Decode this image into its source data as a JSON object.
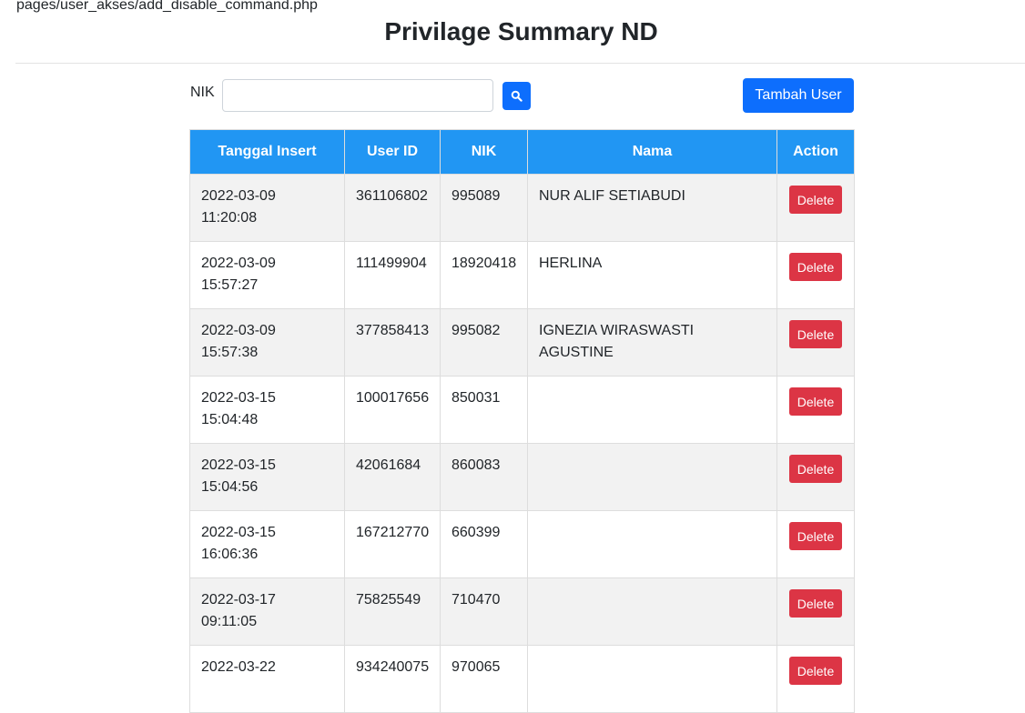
{
  "path": "pages/user_akses/add_disable_command.php",
  "title": "Privilage Summary ND",
  "search": {
    "label": "NIK",
    "value": "",
    "placeholder": ""
  },
  "icons": {
    "search": "search-icon"
  },
  "colors": {
    "primary": "#0d6efd",
    "header": "#2196f3",
    "danger": "#dc3545"
  },
  "tambah_label": "Tambah User",
  "table": {
    "headers": [
      "Tanggal Insert",
      "User ID",
      "NIK",
      "Nama",
      "Action"
    ],
    "rows": [
      {
        "date": "2022-03-09",
        "time": "11:20:08",
        "user_id": "361106802",
        "nik": "995089",
        "nama": "NUR ALIF SETIABUDI",
        "action": "Delete"
      },
      {
        "date": "2022-03-09",
        "time": "15:57:27",
        "user_id": "111499904",
        "nik": "18920418",
        "nama": "HERLINA",
        "action": "Delete"
      },
      {
        "date": "2022-03-09",
        "time": "15:57:38",
        "user_id": "377858413",
        "nik": "995082",
        "nama": "IGNEZIA WIRASWASTI AGUSTINE",
        "action": "Delete"
      },
      {
        "date": "2022-03-15",
        "time": "15:04:48",
        "user_id": "100017656",
        "nik": "850031",
        "nama": "",
        "action": "Delete"
      },
      {
        "date": "2022-03-15",
        "time": "15:04:56",
        "user_id": "42061684",
        "nik": "860083",
        "nama": "",
        "action": "Delete"
      },
      {
        "date": "2022-03-15",
        "time": "16:06:36",
        "user_id": "167212770",
        "nik": "660399",
        "nama": "",
        "action": "Delete"
      },
      {
        "date": "2022-03-17",
        "time": "09:11:05",
        "user_id": "75825549",
        "nik": "710470",
        "nama": "",
        "action": "Delete"
      },
      {
        "date": "2022-03-22",
        "time": "",
        "user_id": "934240075",
        "nik": "970065",
        "nama": "",
        "action": "Delete"
      }
    ]
  }
}
